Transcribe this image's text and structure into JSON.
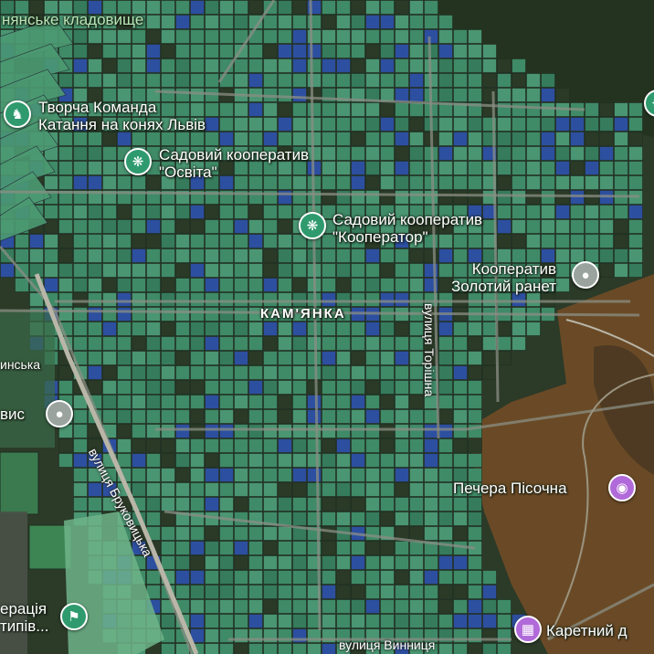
{
  "map": {
    "area_label": "КАМ'ЯНКА",
    "places": [
      {
        "id": "cemetery",
        "text": "нянське кладовище",
        "icon": "cemetery"
      },
      {
        "id": "tvorcha",
        "text": "Творча Команда\nКатання на конях Львів",
        "icon": "horse-riding-icon"
      },
      {
        "id": "osvita",
        "text": "Садовий кооператив\n\"Освіта\"",
        "icon": "garden-cooperative-icon"
      },
      {
        "id": "kooperator",
        "text": "Садовий кооператив\n\"Кооператор\"",
        "icon": "garden-cooperative-icon"
      },
      {
        "id": "zolotyi",
        "text": "Кооператив\nЗолотий ранет",
        "icon": "cooperative-icon"
      },
      {
        "id": "pechera",
        "text": "Печера Пісочна",
        "icon": "camera-icon"
      },
      {
        "id": "karetnyi",
        "text": "Каретний д",
        "icon": "building-icon"
      },
      {
        "id": "vis",
        "text": "вис",
        "icon": "location-pin-icon"
      },
      {
        "id": "ynska",
        "text": "инська",
        "icon": ""
      },
      {
        "id": "federatsia",
        "text": "ерація\nтипів...",
        "icon": "sports-icon"
      }
    ],
    "streets": [
      {
        "id": "brukovytska",
        "text": "вулиця Бруковицька"
      },
      {
        "id": "torishna",
        "text": "вулиця Торішна"
      },
      {
        "id": "vynnytsia",
        "text": "вулиця Винниця"
      }
    ],
    "colors": {
      "plot_fill": "#3f8a67",
      "plot_stroke": "#1e2e22",
      "forest": "#24331f",
      "autumn_forest": "#6a4a26",
      "road": "#8b8f84",
      "pin_green": "#2f9a6e",
      "pin_purple": "#b16ad9"
    }
  }
}
